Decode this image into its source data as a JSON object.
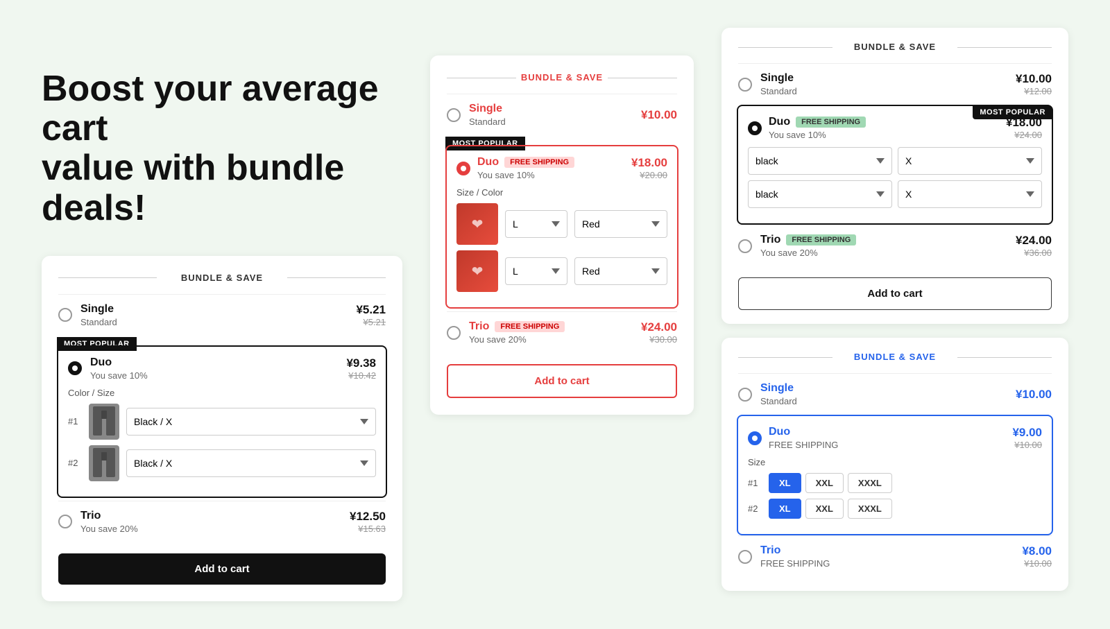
{
  "headline": "Boost your average cart\nvalue with bundle deals!",
  "card1": {
    "title": "BUNDLE & SAVE",
    "options": [
      {
        "id": "single",
        "label": "Single",
        "subtitle": "Standard",
        "price": "¥5.21",
        "originalPrice": "¥5.21",
        "selected": false
      },
      {
        "id": "duo",
        "label": "Duo",
        "subtitle": "You save 10%",
        "price": "¥9.38",
        "originalPrice": "¥10.42",
        "selected": true,
        "mostPopular": true,
        "colorSizeLabel": "Color / Size",
        "items": [
          {
            "num": "#1",
            "value": "Black / X"
          },
          {
            "num": "#2",
            "value": "Black / X"
          }
        ]
      },
      {
        "id": "trio",
        "label": "Trio",
        "subtitle": "You save 20%",
        "price": "¥12.50",
        "originalPrice": "¥15.63",
        "selected": false
      }
    ],
    "addToCart": "Add to cart"
  },
  "card2": {
    "title": "BUNDLE & SAVE",
    "options": [
      {
        "id": "single",
        "label": "Single",
        "subtitle": "Standard",
        "price": "¥10.00",
        "selected": false
      },
      {
        "id": "duo",
        "label": "Duo",
        "badge": "FREE SHIPPING",
        "subtitle": "You save 10%",
        "price": "¥18.00",
        "originalPrice": "¥20.00",
        "selected": true,
        "mostPopular": true,
        "sizeColorLabel": "Size / Color",
        "items": [
          {
            "size": "L",
            "color": "Red"
          },
          {
            "size": "L",
            "color": "Red"
          }
        ]
      },
      {
        "id": "trio",
        "label": "Trio",
        "badge": "FREE SHIPPING",
        "subtitle": "You save 20%",
        "price": "¥24.00",
        "originalPrice": "¥30.00",
        "selected": false
      }
    ],
    "addToCart": "Add to cart"
  },
  "card3": {
    "title": "BUNDLE & SAVE",
    "options": [
      {
        "id": "single",
        "label": "Single",
        "subtitle": "Standard",
        "price": "¥10.00",
        "originalPrice": "¥12.00",
        "selected": false
      },
      {
        "id": "duo",
        "label": "Duo",
        "badge": "FREE SHIPPING",
        "subtitle": "You save 10%",
        "price": "¥18.00",
        "originalPrice": "¥24.00",
        "selected": true,
        "mostPopular": true,
        "selects": [
          {
            "col1": "black",
            "col2": "X"
          },
          {
            "col1": "black",
            "col2": "X"
          }
        ]
      },
      {
        "id": "trio",
        "label": "Trio",
        "badge": "FREE SHIPPING",
        "subtitle": "You save 20%",
        "price": "¥24.00",
        "originalPrice": "¥36.00",
        "selected": false
      }
    ],
    "addToCart": "Add to cart"
  },
  "card4": {
    "title": "BUNDLE & SAVE",
    "options": [
      {
        "id": "single",
        "label": "Single",
        "subtitle": "Standard",
        "price": "¥10.00",
        "selected": false
      },
      {
        "id": "duo",
        "label": "Duo",
        "badge": "FREE SHIPPING",
        "subtitle": "",
        "price": "¥9.00",
        "originalPrice": "¥10.00",
        "selected": true,
        "sizeLabel": "Size",
        "items": [
          {
            "num": "#1",
            "sizes": [
              "XL",
              "XXL",
              "XXXL"
            ],
            "selected": "XL"
          },
          {
            "num": "#2",
            "sizes": [
              "XL",
              "XXL",
              "XXXL"
            ],
            "selected": "XL"
          }
        ]
      },
      {
        "id": "trio",
        "label": "Trio",
        "badge": "FREE SHIPPING",
        "subtitle": "",
        "price": "¥8.00",
        "originalPrice": "¥10.00",
        "selected": false
      }
    ]
  }
}
